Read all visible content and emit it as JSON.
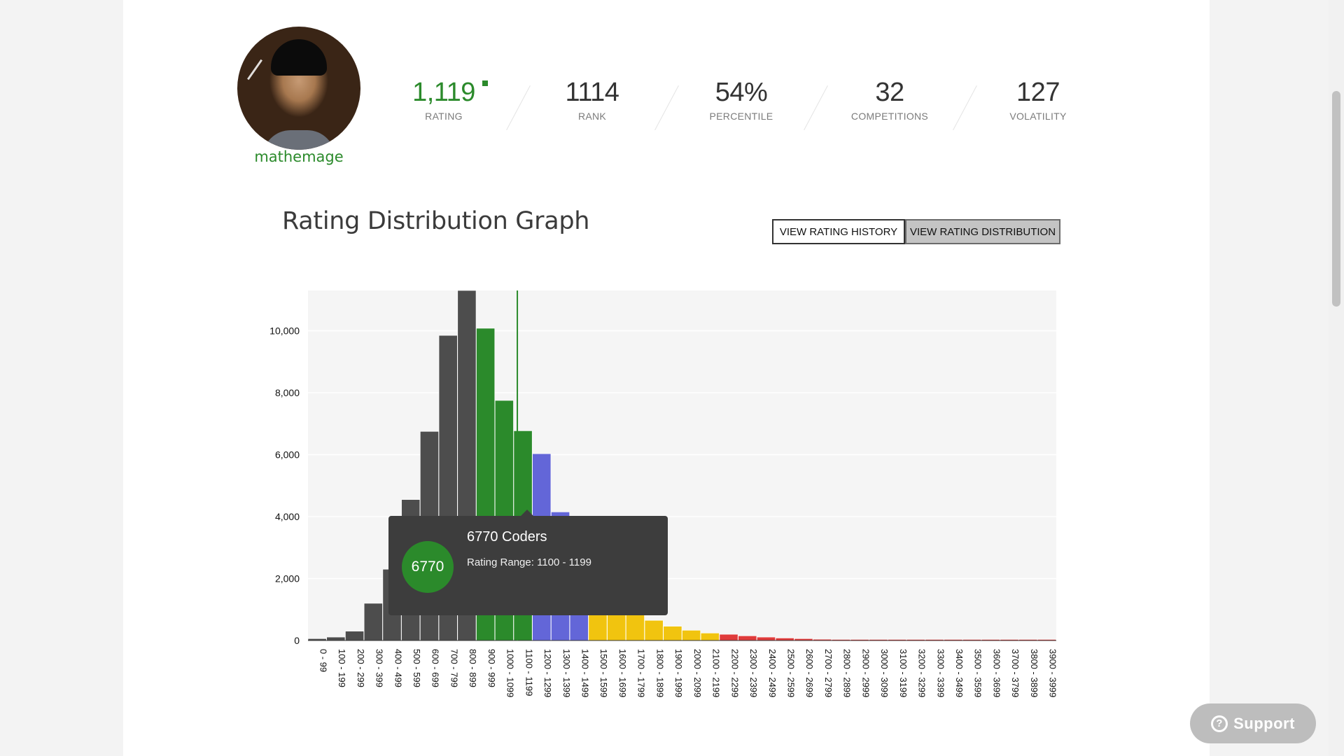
{
  "profile": {
    "username": "mathemage",
    "stats": [
      {
        "value": "1,119",
        "label": "RATING"
      },
      {
        "value": "1114",
        "label": "RANK"
      },
      {
        "value": "54%",
        "label": "PERCENTILE"
      },
      {
        "value": "32",
        "label": "COMPETITIONS"
      },
      {
        "value": "127",
        "label": "VOLATILITY"
      }
    ]
  },
  "section": {
    "title": "Rating Distribution Graph",
    "buttons": {
      "history": "VIEW RATING HISTORY",
      "distribution": "VIEW RATING DISTRIBUTION"
    }
  },
  "tooltip": {
    "count": "6770",
    "title": "6770 Coders",
    "range": "Rating Range: 1100 - 1199"
  },
  "support": {
    "label": "Support"
  },
  "colors": {
    "gray": "#4d4d4d",
    "green": "#2b8a2b",
    "blue": "#6366d8",
    "yellow": "#f1c40f",
    "red": "#e03b3b",
    "grid": "#f5f5f5"
  },
  "chart_data": {
    "type": "bar",
    "ylim": [
      0,
      11300
    ],
    "yticks": [
      0,
      2000,
      4000,
      6000,
      8000,
      10000
    ],
    "ytick_labels": [
      "0",
      "2,000",
      "4,000",
      "6,000",
      "8,000",
      "10,000"
    ],
    "categories": [
      "0 - 99",
      "100 - 199",
      "200 - 299",
      "300 - 399",
      "400 - 499",
      "500 - 599",
      "600 - 699",
      "700 - 799",
      "800 - 899",
      "900 - 999",
      "1000 - 1099",
      "1100 - 1199",
      "1200 - 1299",
      "1300 - 1399",
      "1400 - 1499",
      "1500 - 1599",
      "1600 - 1699",
      "1700 - 1799",
      "1800 - 1899",
      "1900 - 1999",
      "2000 - 2099",
      "2100 - 2199",
      "2200 - 2299",
      "2300 - 2399",
      "2400 - 2499",
      "2500 - 2599",
      "2600 - 2699",
      "2700 - 2799",
      "2800 - 2899",
      "2900 - 2999",
      "3000 - 3099",
      "3100 - 3199",
      "3200 - 3299",
      "3300 - 3399",
      "3400 - 3499",
      "3500 - 3599",
      "3600 - 3699",
      "3700 - 3799",
      "3800 - 3899",
      "3900 - 3999"
    ],
    "values": [
      60,
      110,
      300,
      1200,
      2300,
      4550,
      6750,
      9850,
      11300,
      10080,
      7750,
      6770,
      6030,
      4150,
      3600,
      2200,
      1350,
      900,
      650,
      460,
      330,
      240,
      200,
      150,
      110,
      80,
      60,
      40,
      30,
      20,
      12,
      9,
      7,
      5,
      4,
      3,
      2,
      2,
      1,
      1
    ],
    "bar_colors": [
      "gray",
      "gray",
      "gray",
      "gray",
      "gray",
      "gray",
      "gray",
      "gray",
      "gray",
      "green",
      "green",
      "green",
      "blue",
      "blue",
      "blue",
      "yellow",
      "yellow",
      "yellow",
      "yellow",
      "yellow",
      "yellow",
      "yellow",
      "red",
      "red",
      "red",
      "red",
      "red",
      "red",
      "red",
      "red",
      "red",
      "red",
      "red",
      "red",
      "red",
      "red",
      "red",
      "red",
      "red",
      "red"
    ],
    "marker": {
      "label": "mathemage",
      "value": 1119
    }
  }
}
